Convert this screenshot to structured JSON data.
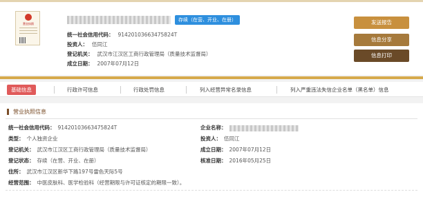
{
  "license_thumb": {
    "title": "营业执照"
  },
  "header": {
    "status": "存续（在营、开业、在册）",
    "credit_code_label": "统一社会信用代码：",
    "credit_code": "91420103663475824T",
    "investor_label": "投资人：",
    "investor": "伍同江",
    "authority_label": "登记机关：",
    "authority": "武汉市江汉区工商行政管理局（质量技术监督局）",
    "founded_label": "成立日期：",
    "founded": "2007年07月12日"
  },
  "actions": {
    "report": "发送报告",
    "share": "信息分享",
    "print": "信息打印"
  },
  "tabs": [
    "基础信息",
    "行政许可信息",
    "行政处罚信息",
    "列入经营异常名录信息",
    "列入严重违法失信企业名单（黑名单）信息"
  ],
  "section": {
    "title": "营业执照信息",
    "left": [
      {
        "label": "统一社会信用代码：",
        "value": "91420103663475824T"
      },
      {
        "label": "类型：",
        "value": "个人独资企业"
      },
      {
        "label": "登记机关：",
        "value": "武汉市江汉区工商行政管理局（质量技术监督局）"
      },
      {
        "label": "登记状态：",
        "value": "存续（在营、开业、在册）"
      },
      {
        "label": "住所：",
        "value": "武汉市江汉区新华下路197号雷色天际5号"
      },
      {
        "label": "经营范围：",
        "value": "中医皮肤科、医学检验科（经营期限与许可证核定的期限一致）。"
      }
    ],
    "right": [
      {
        "label": "企业名称：",
        "value": ""
      },
      {
        "label": "投资人：",
        "value": "伍同江"
      },
      {
        "label": "成立日期：",
        "value": "2007年07月12日"
      },
      {
        "label": "核准日期：",
        "value": "2016年05月25日"
      }
    ]
  },
  "colors": {
    "accent_gold": "#d6a94c",
    "active_tab": "#e05a5a",
    "status_badge": "#2e8fde"
  }
}
